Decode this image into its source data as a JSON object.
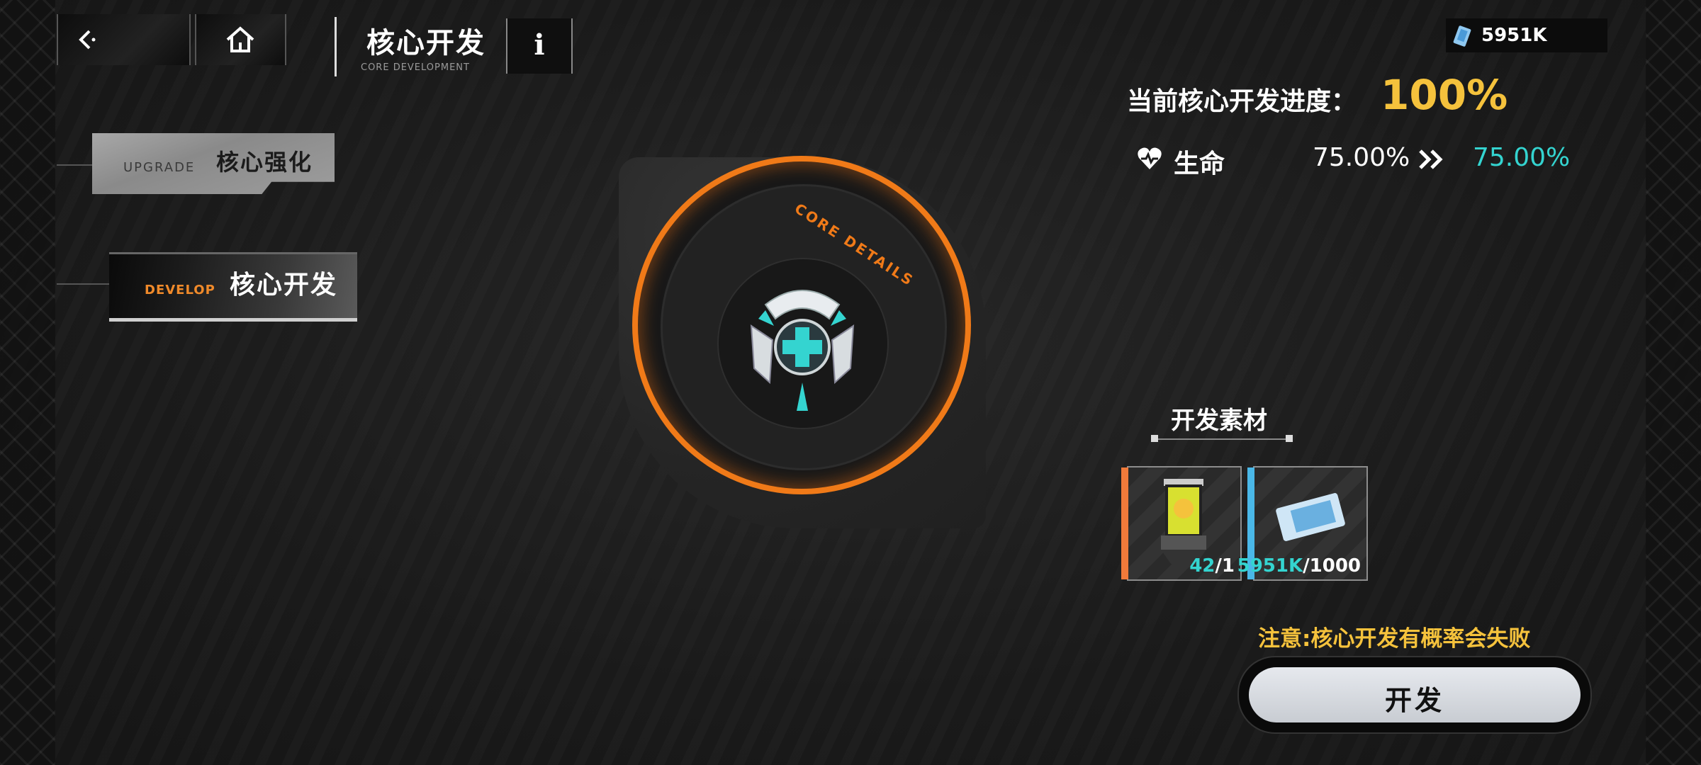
{
  "header": {
    "title": "核心开发",
    "subtitle": "CORE DEVELOPMENT",
    "info_label": "i"
  },
  "currency": {
    "amount": "5951K",
    "icon": "ticket-icon"
  },
  "tabs": [
    {
      "en": "UPGRADE",
      "cn": "核心强化",
      "active": false
    },
    {
      "en": "DEVELOP",
      "cn": "核心开发",
      "active": true
    }
  ],
  "core": {
    "label": "CORE DETAILS",
    "emblem": "medical-cross-emblem"
  },
  "progress": {
    "label": "当前核心开发进度：",
    "value": "100%"
  },
  "stat": {
    "name": "生命",
    "current": "75.00%",
    "next": "75.00%",
    "icon": "heart-icon"
  },
  "materials": {
    "title": "开发素材",
    "items": [
      {
        "have": "42",
        "need": "/1",
        "accent": "#f07a3a",
        "icon": "core-capsule-icon"
      },
      {
        "have": "5951K",
        "need": "/1000",
        "accent": "#4ab8e8",
        "icon": "ticket-icon"
      }
    ]
  },
  "warning": "注意:核心开发有概率会失败",
  "action": {
    "label": "开发"
  },
  "colors": {
    "accent_orange": "#f07a18",
    "accent_cyan": "#34d4d0",
    "accent_yellow": "#f5c23c"
  }
}
